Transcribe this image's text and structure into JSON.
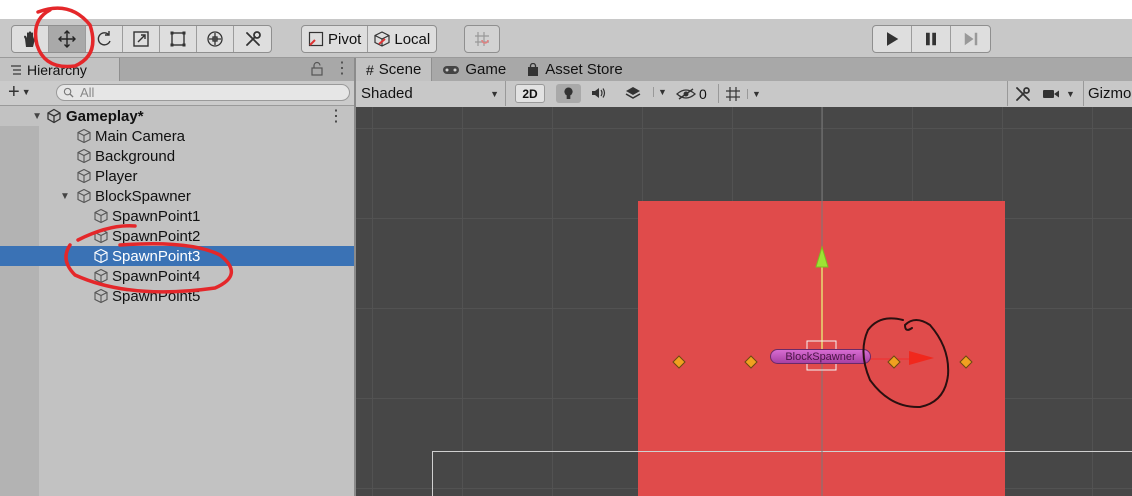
{
  "toolbar": {
    "tools": [
      "hand-tool",
      "move-tool",
      "rotate-tool",
      "scale-tool",
      "rect-tool",
      "transform-tool",
      "custom-tool"
    ],
    "active_tool": "move-tool",
    "pivot_label": "Pivot",
    "local_label": "Local"
  },
  "hierarchy": {
    "tab_label": "Hierarchy",
    "search_placeholder": "All",
    "scene_name": "Gameplay*",
    "items": [
      {
        "label": "Main Camera",
        "depth": 1
      },
      {
        "label": "Background",
        "depth": 1
      },
      {
        "label": "Player",
        "depth": 1
      },
      {
        "label": "BlockSpawner",
        "depth": 1,
        "expanded": true
      },
      {
        "label": "SpawnPoint1",
        "depth": 2
      },
      {
        "label": "SpawnPoint2",
        "depth": 2
      },
      {
        "label": "SpawnPoint3",
        "depth": 2,
        "selected": true
      },
      {
        "label": "SpawnPoint4",
        "depth": 2
      },
      {
        "label": "SpawnPoint5",
        "depth": 2
      }
    ]
  },
  "scene_view": {
    "tabs": [
      "Scene",
      "Game",
      "Asset Store"
    ],
    "active_tab": "Scene",
    "shading_mode": "Shaded",
    "mode_2d_label": "2D",
    "hidden_count": "0",
    "gizmos_label": "Gizmo",
    "object_label": "BlockSpawner"
  },
  "colors": {
    "selection": "#3a72b5",
    "block_fill": "#e04b4b",
    "annotation": "#e4272a"
  }
}
